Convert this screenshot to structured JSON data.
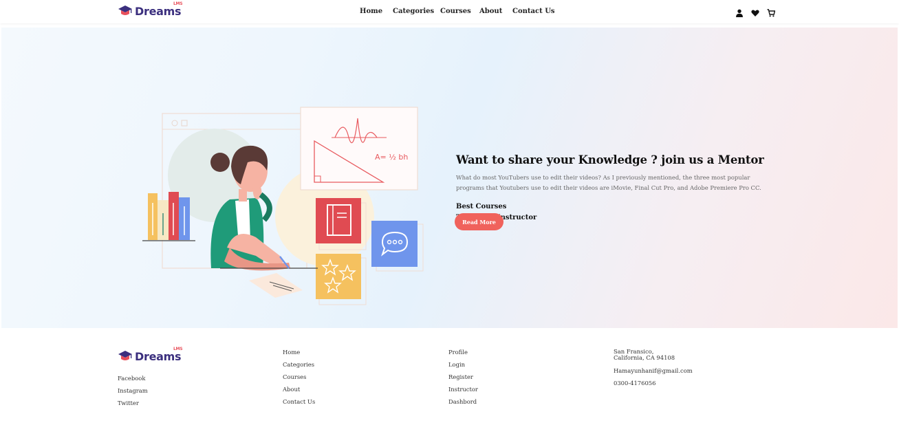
{
  "brand": {
    "name": "Dreams",
    "suffix": "LMS"
  },
  "colors": {
    "brand_purple": "#3b2f7e",
    "accent_red": "#f0625c",
    "brand_pink": "#e8505b"
  },
  "nav": {
    "items": [
      {
        "label": "Home"
      },
      {
        "label": "Categories"
      },
      {
        "label": "Courses"
      },
      {
        "label": "About"
      },
      {
        "label": "Contact Us"
      }
    ]
  },
  "header_icons": [
    "user-icon",
    "heart-icon",
    "cart-icon"
  ],
  "hero": {
    "title": "Want to share your Knowledge ? join us a Mentor",
    "description": "What do most YouTubers use to edit their videos? As I previously mentioned, the three most popular programs that Youtubers use to edit their videos are iMovie, Final Cut Pro, and Adobe Premiere Pro CC.",
    "points": [
      "Best Courses",
      "Top Rated Instructor"
    ],
    "button_label": "Read More",
    "illustration_formula": "A= ½ bh"
  },
  "footer": {
    "social": [
      "Facebook",
      "Instagram",
      "Twitter"
    ],
    "links_col1": [
      "Home",
      "Categories",
      "Courses",
      "About",
      "Contact Us"
    ],
    "links_col2": [
      "Profile",
      "Login",
      "Register",
      "Instructor",
      "Dashbord"
    ],
    "contact": {
      "address_line1": "San Fransico,",
      "address_line2": "California, CA 94108",
      "email": "Hamayunhanif@gmail.com",
      "phone": "0300-4176056"
    }
  }
}
